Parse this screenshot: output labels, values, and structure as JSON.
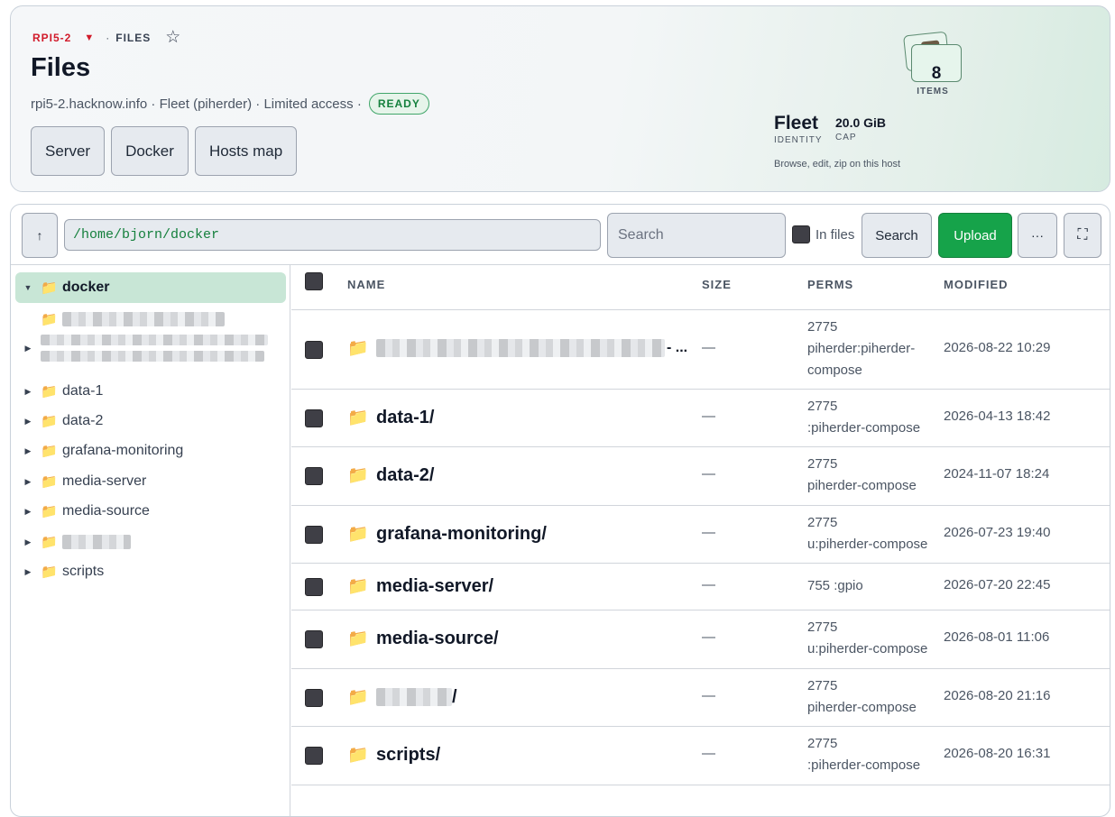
{
  "breadcrumb": {
    "host": "RPI5-2",
    "caret": "▼",
    "separator": "·",
    "page": "FILES",
    "star": "☆"
  },
  "title": "Files",
  "meta": {
    "text": "rpi5-2.hacknow.info · Fleet (piherder) · Limited access ·",
    "status": "READY"
  },
  "header_buttons": [
    "Server",
    "Docker",
    "Hosts map"
  ],
  "stats": {
    "items_value": "8",
    "items_label": "ITEMS",
    "identity_value": "Fleet",
    "identity_label": "IDENTITY",
    "cap_value": "20.0 GiB",
    "cap_label": "CAP",
    "note": "Browse, edit, zip on this host"
  },
  "toolbar": {
    "up_label": "↑",
    "path": "/home/bjorn/docker",
    "search_placeholder": "Search",
    "in_files_label": "In files",
    "search_label": "Search",
    "upload_label": "Upload",
    "more_label": "···",
    "fullscreen_label": "⛶"
  },
  "tree": {
    "root": "docker",
    "items": [
      "data-1",
      "data-2",
      "grafana-monitoring",
      "media-server",
      "media-source",
      "scripts"
    ]
  },
  "table": {
    "headers": {
      "name": "NAME",
      "size": "SIZE",
      "perms": "PERMS",
      "modified": "MODIFIED"
    },
    "rows": [
      {
        "name": "",
        "size": "—",
        "perm_mode": "2775",
        "perm_owner": "piherder:piherder-compose",
        "modified": "2026-08-22 10:29"
      },
      {
        "name": "data-1/",
        "size": "—",
        "perm_mode": "2775",
        "perm_owner": ":piherder-compose",
        "modified": "2026-04-13 18:42"
      },
      {
        "name": "data-2/",
        "size": "—",
        "perm_mode": "2775",
        "perm_owner": "piherder-compose",
        "modified": "2024-11-07 18:24"
      },
      {
        "name": "grafana-monitoring/",
        "size": "—",
        "perm_mode": "2775",
        "perm_owner": "u:piherder-compose",
        "modified": "2026-07-23 19:40"
      },
      {
        "name": "media-server/",
        "size": "—",
        "perm_mode": "755",
        "perm_owner": ":gpio",
        "modified": "2026-07-20 22:45"
      },
      {
        "name": "media-source/",
        "size": "—",
        "perm_mode": "2775",
        "perm_owner": "u:piherder-compose",
        "modified": "2026-08-01 11:06"
      },
      {
        "name": "/",
        "size": "—",
        "perm_mode": "2775",
        "perm_owner": "piherder-compose",
        "modified": "2026-08-20 21:16"
      },
      {
        "name": "scripts/",
        "size": "—",
        "perm_mode": "2775",
        "perm_owner": ":piherder-compose",
        "modified": "2026-08-20 16:31"
      }
    ]
  }
}
